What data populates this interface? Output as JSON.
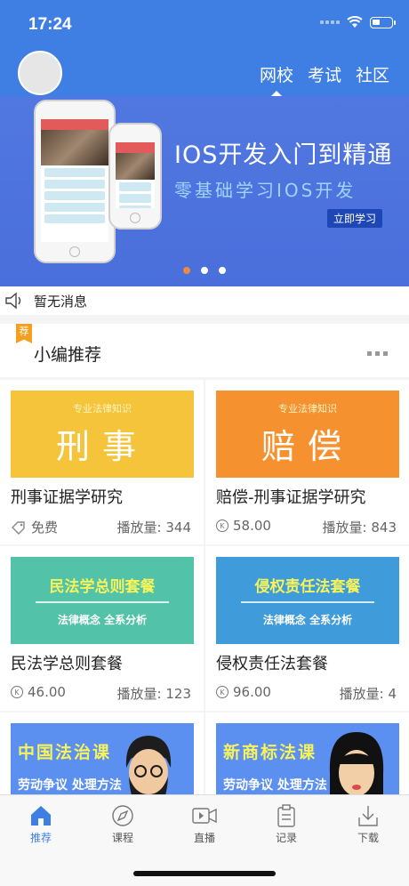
{
  "status": {
    "time": "17:24"
  },
  "header": {
    "tabs": [
      "网校",
      "考试",
      "社区"
    ],
    "active_tab": 0
  },
  "banner": {
    "title": "IOS开发入门到精通",
    "subtitle": "零基础学习IOS开发",
    "button": "立即学习",
    "dots": 3,
    "active_dot": 0
  },
  "message": {
    "text": "暂无消息"
  },
  "section": {
    "tag": "荐",
    "title": "小编推荐"
  },
  "courses": [
    {
      "thumb_small": "专业法律知识",
      "thumb_big": "刑事",
      "title": "刑事证据学研究",
      "price": "免费",
      "plays": "播放量: 344",
      "color": "#f5c43a"
    },
    {
      "thumb_small": "专业法律知识",
      "thumb_big": "赔偿",
      "title": "赔偿-刑事证据学研究",
      "price": "58.00",
      "plays": "播放量: 843",
      "color": "#f6912f"
    },
    {
      "thumb_pkg": "民法学总则套餐",
      "thumb_pkgsub": "法律概念 全系分析",
      "title": "民法学总则套餐",
      "price": "46.00",
      "plays": "播放量: 123",
      "color": "#52c2a8"
    },
    {
      "thumb_pkg": "侵权责任法套餐",
      "thumb_pkgsub": "法律概念 全系分析",
      "title": "侵权责任法套餐",
      "price": "96.00",
      "plays": "播放量: 4",
      "color": "#3f9bd9"
    },
    {
      "thumb_pkg": "中国法治课",
      "thumb_pkgsub": "劳动争议 处理方法",
      "color": "#5b8ff0"
    },
    {
      "thumb_pkg": "新商标法课",
      "thumb_pkgsub": "劳动争议 处理方法",
      "color": "#5b8ff0"
    }
  ],
  "tabbar": {
    "items": [
      "推荐",
      "课程",
      "直播",
      "记录",
      "下载"
    ],
    "icons": [
      "house-icon",
      "compass-icon",
      "video-icon",
      "clipboard-icon",
      "download-icon"
    ],
    "active": 0
  },
  "colors": {
    "primary": "#3f7fe3",
    "accent": "#ee8a3a"
  }
}
